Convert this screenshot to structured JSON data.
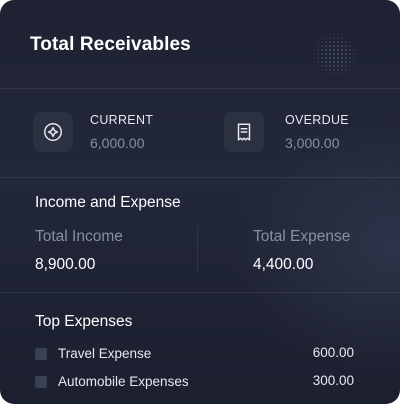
{
  "card": {
    "title": "Total Receivables"
  },
  "receivables": {
    "current": {
      "label": "CURRENT",
      "value": "6,000.00",
      "icon": "compass-icon"
    },
    "overdue": {
      "label": "OVERDUE",
      "value": "3,000.00",
      "icon": "receipt-icon"
    }
  },
  "income_expense": {
    "title": "Income and Expense",
    "income": {
      "label": "Total Income",
      "value": "8,900.00"
    },
    "expense": {
      "label": "Total Expense",
      "value": "4,400.00"
    }
  },
  "top_expenses": {
    "title": "Top Expenses",
    "items": [
      {
        "label": "Travel Expense",
        "value": "600.00"
      },
      {
        "label": "Automobile Expenses",
        "value": "300.00"
      }
    ]
  },
  "colors": {
    "card_bg": "#1e2232",
    "icon_bg": "#2c3142",
    "muted_text": "#8a8f9e",
    "text": "#ffffff"
  }
}
